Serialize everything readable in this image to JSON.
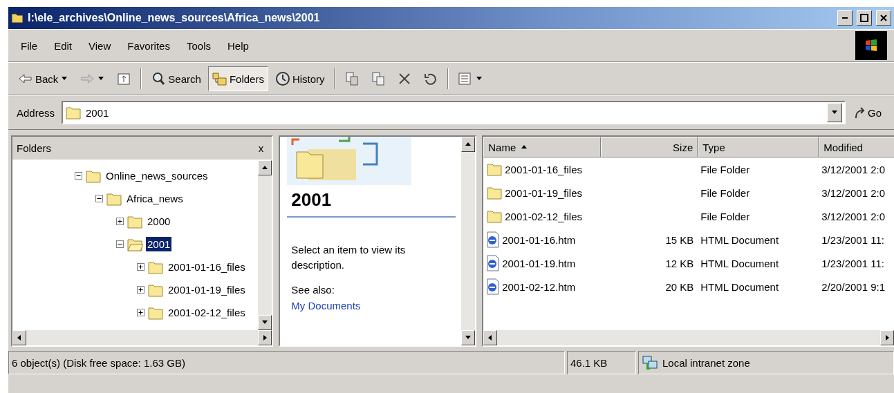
{
  "window": {
    "title": "I:\\ele_archives\\Online_news_sources\\Africa_news\\2001"
  },
  "menu": [
    "File",
    "Edit",
    "View",
    "Favorites",
    "Tools",
    "Help"
  ],
  "toolbar": [
    {
      "kind": "back",
      "label": "Back",
      "selected": false
    },
    {
      "kind": "forward",
      "selected": false
    },
    {
      "kind": "up",
      "selected": false
    },
    {
      "kind": "search",
      "label": "Search",
      "selected": false
    },
    {
      "kind": "folders",
      "label": "Folders",
      "selected": true
    },
    {
      "kind": "history",
      "label": "History",
      "selected": false
    },
    {
      "kind": "move",
      "selected": false
    },
    {
      "kind": "copy",
      "selected": false
    },
    {
      "kind": "delete",
      "selected": false
    },
    {
      "kind": "undo",
      "selected": false
    },
    {
      "kind": "views",
      "selected": false
    }
  ],
  "address": {
    "label": "Address",
    "value": "2001",
    "go": "Go"
  },
  "folders_pane": {
    "title": "Folders",
    "close": "x",
    "tree": [
      {
        "label": "Online_news_sources",
        "expanded": true,
        "selected": false,
        "children": [
          {
            "label": "Africa_news",
            "expanded": true,
            "selected": false,
            "children": [
              {
                "label": "2000",
                "expanded": false,
                "selected": false
              },
              {
                "label": "2001",
                "expanded": true,
                "selected": true,
                "children": [
                  {
                    "label": "2001-01-16_files",
                    "expanded": false,
                    "selected": false
                  },
                  {
                    "label": "2001-01-19_files",
                    "expanded": false,
                    "selected": false
                  },
                  {
                    "label": "2001-02-12_files",
                    "expanded": false,
                    "selected": false
                  }
                ]
              }
            ]
          }
        ]
      }
    ]
  },
  "info_pane": {
    "title": "2001",
    "description": "Select an item to view its description.",
    "see_also": "See also:",
    "link": "My Documents"
  },
  "file_list": {
    "columns": [
      "Name",
      "Size",
      "Type",
      "Modified"
    ],
    "rows": [
      {
        "kind": "folder",
        "name": "2001-01-16_files",
        "type": "File Folder",
        "modified": "3/12/2001 2:0"
      },
      {
        "kind": "folder",
        "name": "2001-01-19_files",
        "type": "File Folder",
        "modified": "3/12/2001 2:0"
      },
      {
        "kind": "folder",
        "name": "2001-02-12_files",
        "type": "File Folder",
        "modified": "3/12/2001 2:0"
      },
      {
        "kind": "html",
        "name": "2001-01-16.htm",
        "size": "15 KB",
        "type": "HTML Document",
        "modified": "1/23/2001 11:"
      },
      {
        "kind": "html",
        "name": "2001-01-19.htm",
        "size": "12 KB",
        "type": "HTML Document",
        "modified": "1/23/2001 11:"
      },
      {
        "kind": "html",
        "name": "2001-02-12.htm",
        "size": "20 KB",
        "type": "HTML Document",
        "modified": "2/20/2001 9:1"
      }
    ]
  },
  "status_bar": {
    "objects": "6 object(s) (Disk free space: 1.63 GB)",
    "size": "46.1 KB",
    "zone": "Local intranet zone"
  }
}
